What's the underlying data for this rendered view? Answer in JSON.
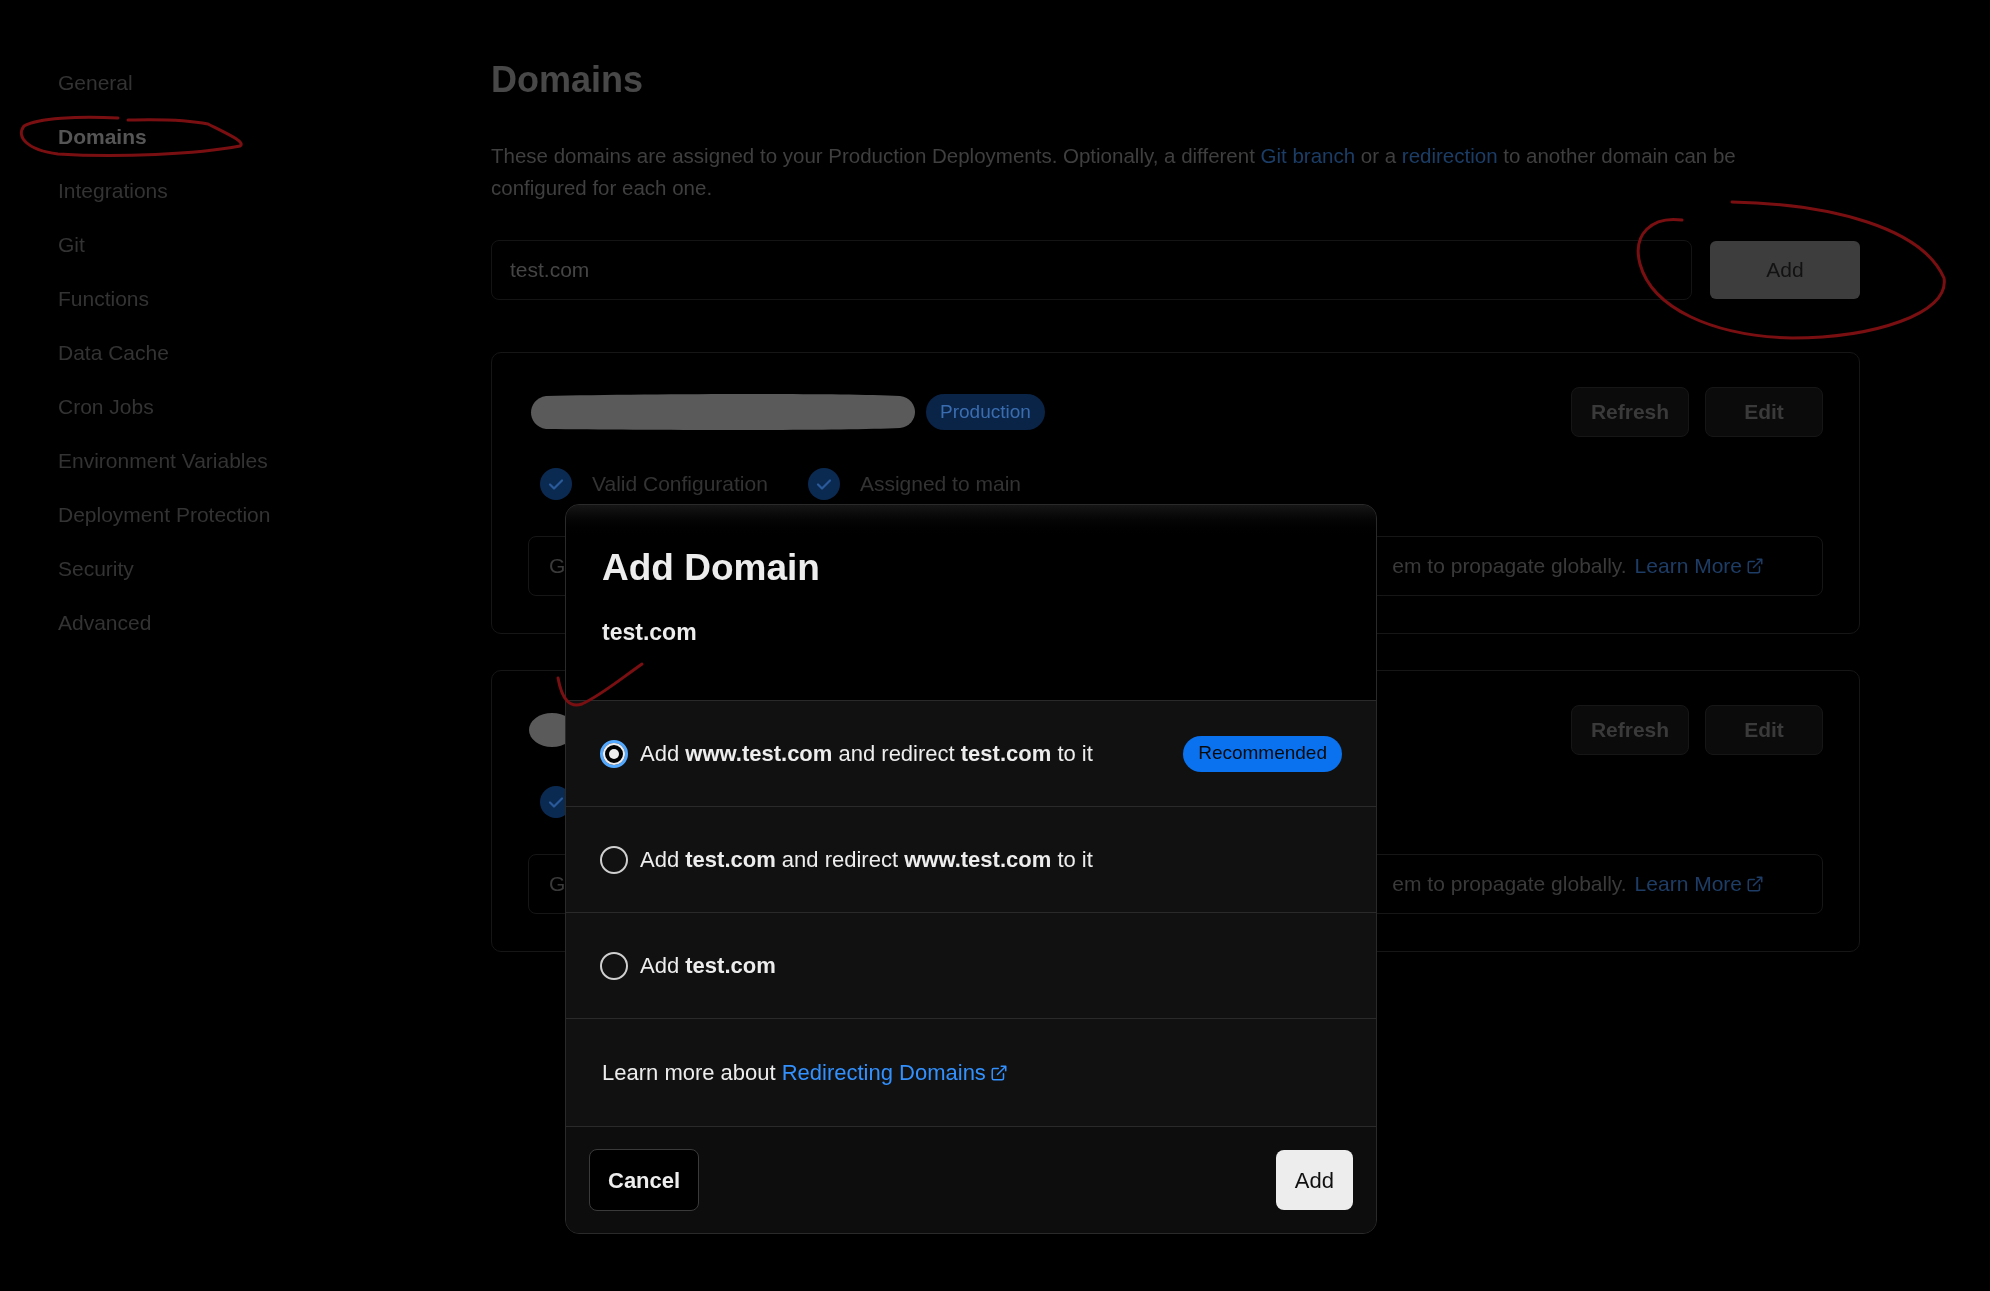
{
  "sidebar": {
    "items": [
      {
        "label": "General",
        "selected": false
      },
      {
        "label": "Domains",
        "selected": true
      },
      {
        "label": "Integrations",
        "selected": false
      },
      {
        "label": "Git",
        "selected": false
      },
      {
        "label": "Functions",
        "selected": false
      },
      {
        "label": "Data Cache",
        "selected": false
      },
      {
        "label": "Cron Jobs",
        "selected": false
      },
      {
        "label": "Environment Variables",
        "selected": false
      },
      {
        "label": "Deployment Protection",
        "selected": false
      },
      {
        "label": "Security",
        "selected": false
      },
      {
        "label": "Advanced",
        "selected": false
      }
    ]
  },
  "page": {
    "title": "Domains",
    "description": [
      {
        "kind": "text",
        "text": "These domains are assigned to your Production Deployments. Optionally, a different "
      },
      {
        "kind": "link",
        "text": "Git branch"
      },
      {
        "kind": "text",
        "text": " or a "
      },
      {
        "kind": "link",
        "text": "redirection"
      },
      {
        "kind": "text",
        "text": " to another domain can be configured for each one."
      }
    ]
  },
  "add_form": {
    "value": "test.com",
    "button": "Add"
  },
  "domains": [
    {
      "badge": "Production",
      "buttons": [
        "Refresh",
        "Edit"
      ],
      "checks": [
        {
          "label": "Valid Configuration",
          "checked": true
        },
        {
          "label": "Assigned to main",
          "checked": true
        }
      ],
      "note_start": "G",
      "note_end": "em to propagate globally.",
      "note_link": "Learn More"
    },
    {
      "buttons": [
        "Refresh",
        "Edit"
      ],
      "checks": [
        {
          "checked": true
        }
      ],
      "note_start": "G",
      "note_end": "em to propagate globally.",
      "note_link": "Learn More"
    }
  ],
  "dialog": {
    "title": "Add Domain",
    "domain": "test.com",
    "options": [
      {
        "label": "Add **www.test.com** and redirect **test.com** to it",
        "selected": true,
        "badge": "Recommended"
      },
      {
        "label": "Add **test.com** and redirect **www.test.com** to it",
        "selected": false
      },
      {
        "label": "Add **test.com**",
        "selected": false
      }
    ],
    "learn_more": {
      "text": "Learn more about",
      "link": "Redirecting Domains"
    },
    "buttons": [
      {
        "label": "Cancel",
        "kind": "secondary"
      },
      {
        "label": "Add",
        "kind": "primary"
      }
    ]
  }
}
